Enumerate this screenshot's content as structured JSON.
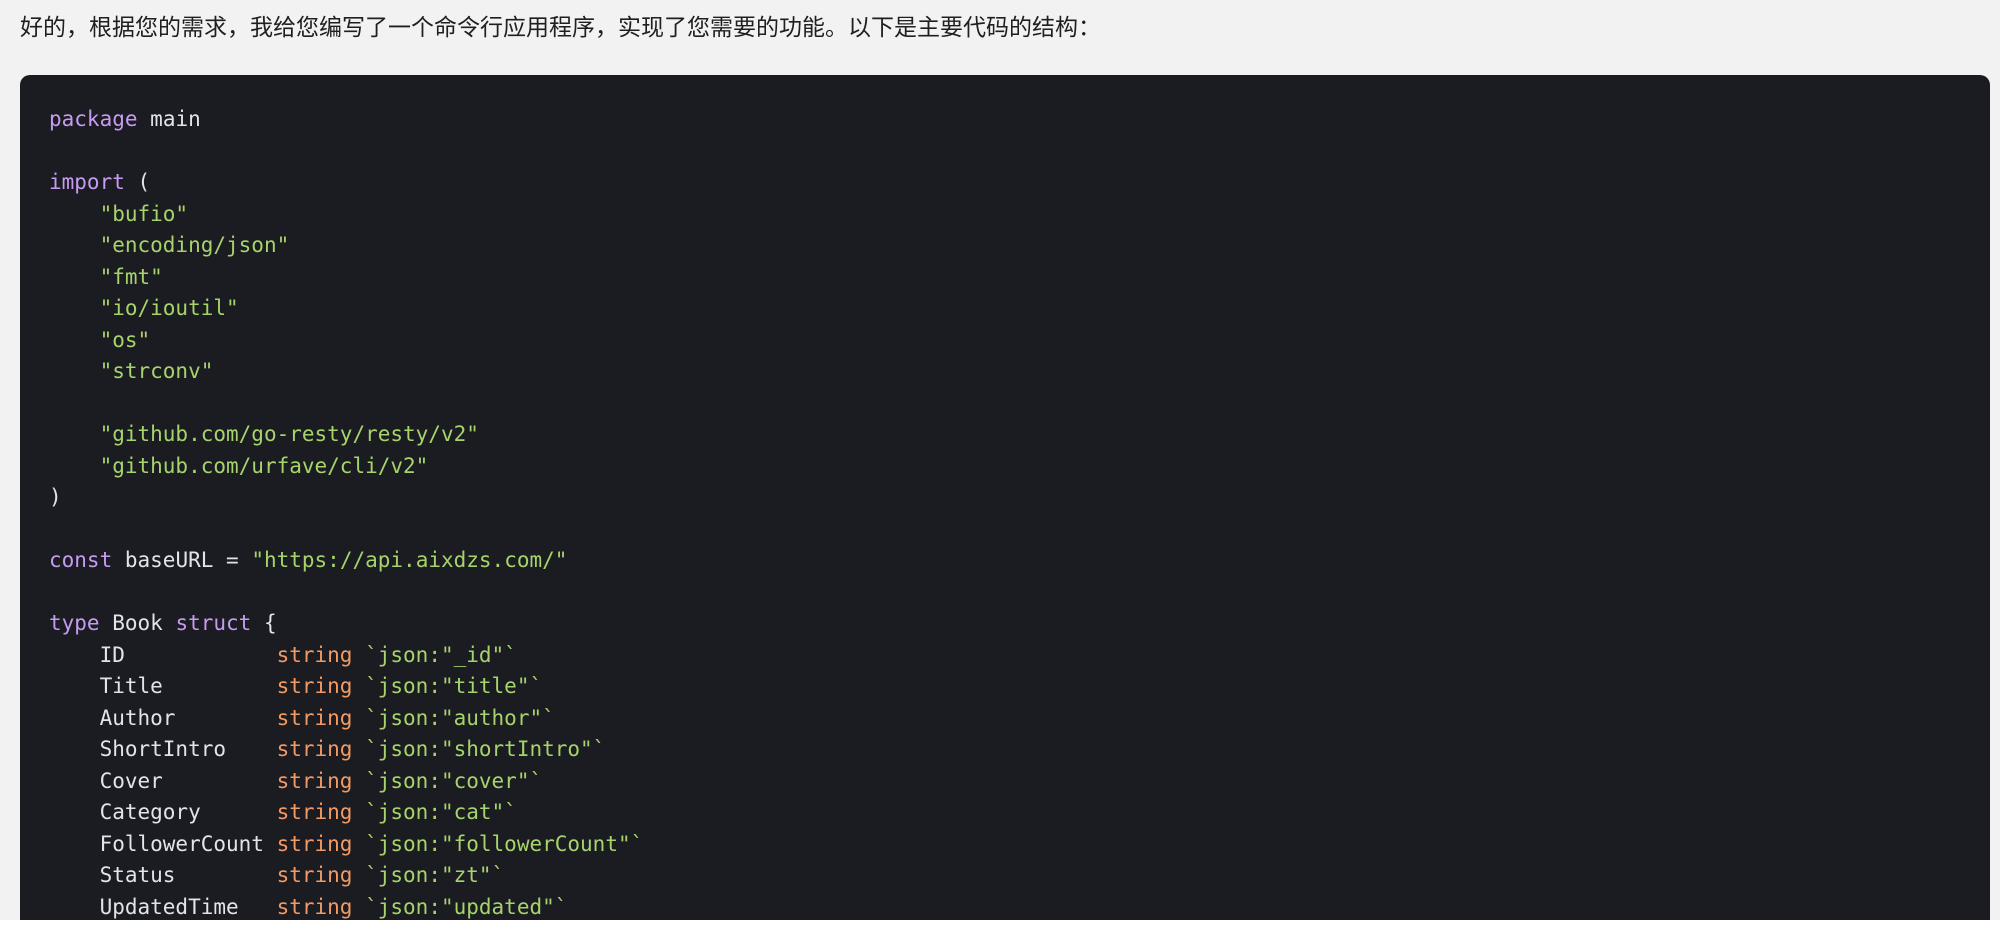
{
  "message": {
    "intro": "好的，根据您的需求，我给您编写了一个命令行应用程序，实现了您需要的功能。以下是主要代码的结构："
  },
  "code": {
    "language": "go",
    "package_keyword": "package",
    "package_name": "main",
    "import_keyword": "import",
    "imports_std": [
      "\"bufio\"",
      "\"encoding/json\"",
      "\"fmt\"",
      "\"io/ioutil\"",
      "\"os\"",
      "\"strconv\""
    ],
    "imports_ext": [
      "\"github.com/go-resty/resty/v2\"",
      "\"github.com/urfave/cli/v2\""
    ],
    "const_keyword": "const",
    "const_name": "baseURL",
    "const_value": "\"https://api.aixdzs.com/\"",
    "type_keyword": "type",
    "struct_name": "Book",
    "struct_keyword": "struct",
    "field_type": "string",
    "fields": [
      {
        "name": "ID            ",
        "tag": "`json:\"_id\"`"
      },
      {
        "name": "Title         ",
        "tag": "`json:\"title\"`"
      },
      {
        "name": "Author        ",
        "tag": "`json:\"author\"`"
      },
      {
        "name": "ShortIntro    ",
        "tag": "`json:\"shortIntro\"`"
      },
      {
        "name": "Cover         ",
        "tag": "`json:\"cover\"`"
      },
      {
        "name": "Category      ",
        "tag": "`json:\"cat\"`"
      },
      {
        "name": "FollowerCount ",
        "tag": "`json:\"followerCount\"`"
      },
      {
        "name": "Status        ",
        "tag": "`json:\"zt\"`"
      },
      {
        "name": "UpdatedTime   ",
        "tag": "`json:\"updated\"`"
      }
    ]
  },
  "colors": {
    "page_background": "#f2f2f2",
    "code_background": "#1b1b22",
    "keyword": "#c79bf1",
    "string": "#a6d46a",
    "type": "#f39a63",
    "plain": "#e2e4ec"
  }
}
